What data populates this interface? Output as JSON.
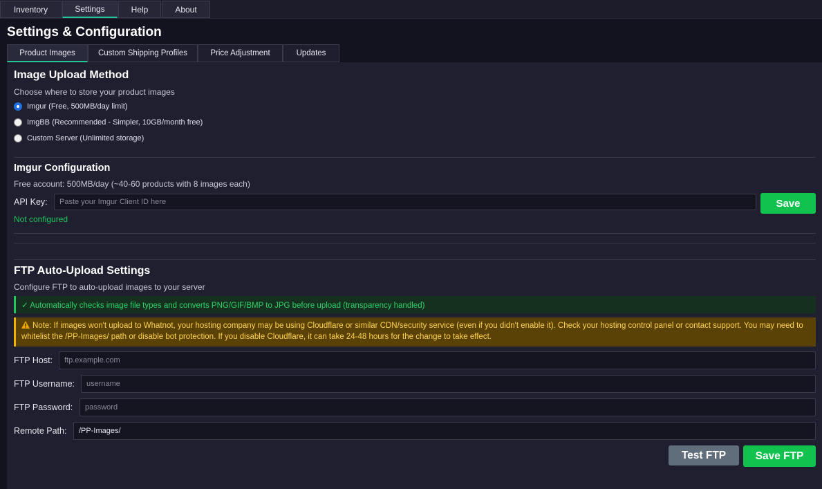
{
  "menu": {
    "tabs": [
      "Inventory",
      "Settings",
      "Help",
      "About"
    ],
    "active": "Settings"
  },
  "page": {
    "title": "Settings & Configuration"
  },
  "subtabs": {
    "items": [
      "Product Images",
      "Custom Shipping Profiles",
      "Price Adjustment",
      "Updates"
    ],
    "active": "Product Images"
  },
  "upload_method": {
    "title": "Image Upload Method",
    "description": "Choose where to store your product images",
    "options": [
      {
        "label": "Imgur (Free, 500MB/day limit)",
        "checked": true
      },
      {
        "label": "ImgBB (Recommended - Simpler, 10GB/month free)",
        "checked": false
      },
      {
        "label": "Custom Server (Unlimited storage)",
        "checked": false
      }
    ]
  },
  "imgur": {
    "title": "Imgur Configuration",
    "description": "Free account: 500MB/day (~40-60 products with 8 images each)",
    "api_label": "API Key:",
    "api_placeholder": "Paste your Imgur Client ID here",
    "api_value": "",
    "save_label": "Save",
    "status": "Not configured",
    "status_color": "#22c55e"
  },
  "ftp": {
    "title": "FTP Auto-Upload Settings",
    "description": "Configure FTP to auto-upload images to your server",
    "info_text": "✓ Automatically checks image file types and converts PNG/GIF/BMP to JPG before upload (transparency handled)",
    "warning_text": "Note: If images won't upload to Whatnot, your hosting company may be using Cloudflare or similar CDN/security service (even if you didn't enable it). Check your hosting control panel or contact support. You may need to whitelist the /PP-Images/ path or disable bot protection. If you disable Cloudflare, it can take 24-48 hours for the change to take effect.",
    "host_label": "FTP Host:",
    "host_placeholder": "ftp.example.com",
    "username_label": "FTP Username:",
    "username_placeholder": "username",
    "password_label": "FTP Password:",
    "password_placeholder": "password",
    "path_label": "Remote Path:",
    "path_value": "/PP-Images/",
    "test_label": "Test FTP",
    "save_label": "Save FTP"
  },
  "colors": {
    "accent": "#20c997",
    "primary_button": "#12c24e",
    "secondary_button": "#5f6e7a",
    "warning_bg": "#5a4206",
    "info_bg": "#16301f"
  }
}
